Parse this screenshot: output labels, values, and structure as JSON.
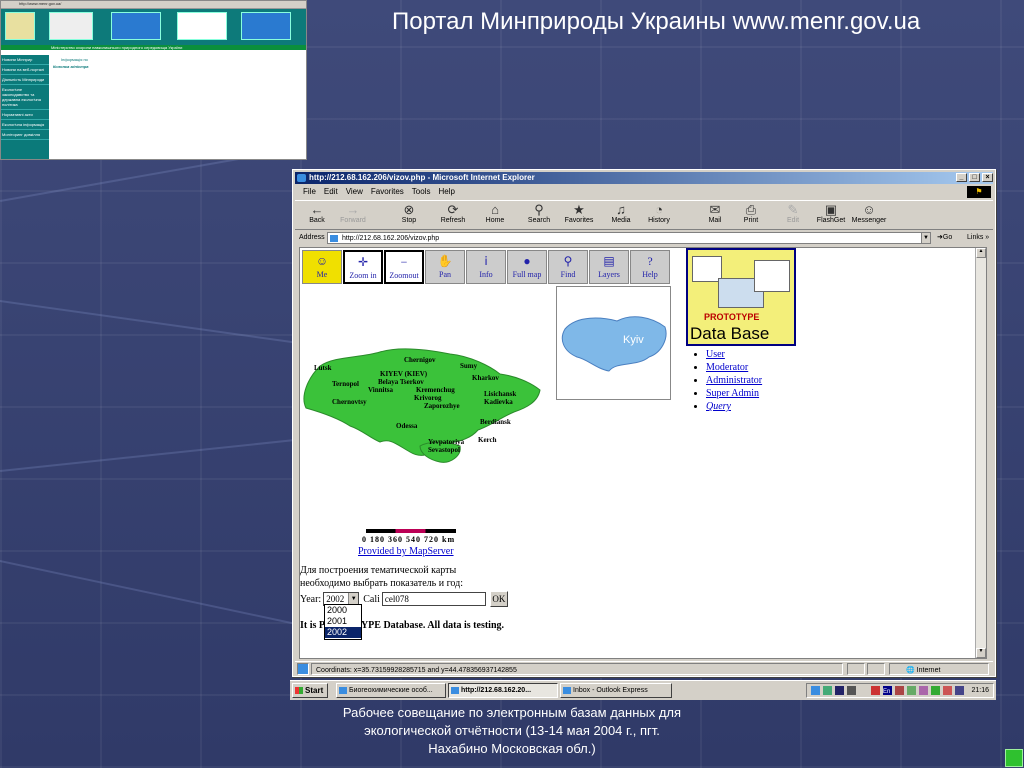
{
  "slide": {
    "title": "Портал Минприроды Украины www.menr.gov.ua",
    "caption": "Рабочее совещание по электронным базам данных для экологической отчётности (13-14 мая 2004 г., пгт. Нахабино Московская обл.)"
  },
  "thumbnail": {
    "address": "http://www.menr.gov.ua/",
    "strip_text": "Міністерство охорони навколишнього природного середовища України",
    "menu_items": [
      "Новини Мінприр",
      "Новини на веб-порталі",
      "Діяльність Мінприроди",
      "Екологічне законодавство та державна екологічна політика",
      "Нормативні акти",
      "Екологічна інформація",
      "Моніторинг довкілля"
    ],
    "body_title": "Колонка міністра",
    "info_label": "Інформація по"
  },
  "window": {
    "title": "http://212.68.162.206/vizov.php - Microsoft Internet Explorer",
    "menu": [
      "File",
      "Edit",
      "View",
      "Favorites",
      "Tools",
      "Help"
    ],
    "toolbar": [
      {
        "label": "Back",
        "icon": "←",
        "disabled": false
      },
      {
        "label": "Forward",
        "icon": "→",
        "disabled": true
      },
      {
        "label": "Stop",
        "icon": "⊗",
        "disabled": false
      },
      {
        "label": "Refresh",
        "icon": "⟳",
        "disabled": false
      },
      {
        "label": "Home",
        "icon": "⌂",
        "disabled": false
      },
      {
        "label": "Search",
        "icon": "⚲",
        "disabled": false
      },
      {
        "label": "Favorites",
        "icon": "★",
        "disabled": false
      },
      {
        "label": "Media",
        "icon": "♫",
        "disabled": false
      },
      {
        "label": "History",
        "icon": "◔",
        "disabled": false
      },
      {
        "label": "Mail",
        "icon": "✉",
        "disabled": false
      },
      {
        "label": "Print",
        "icon": "⎙",
        "disabled": false
      },
      {
        "label": "Edit",
        "icon": "✎",
        "disabled": true
      },
      {
        "label": "FlashGet",
        "icon": "▣",
        "disabled": false
      },
      {
        "label": "Messenger",
        "icon": "☺",
        "disabled": false
      }
    ],
    "address_label": "Address",
    "address": "http://212.68.162.206/vizov.php",
    "go_label": "Go",
    "links_label": "Links",
    "status_coords": "Coordinats: x=35.73159928285715  and y=44.4783569371428​55",
    "status_zone": "Internet"
  },
  "page": {
    "map_buttons": [
      {
        "label": "Me",
        "icon": "☺",
        "state": "active"
      },
      {
        "label": "Zoom in",
        "icon": "✛",
        "state": "sel"
      },
      {
        "label": "Zoomout",
        "icon": "−",
        "state": "sel"
      },
      {
        "label": "Pan",
        "icon": "✋",
        "state": "normal"
      },
      {
        "label": "Info",
        "icon": "ⅰ",
        "state": "normal"
      },
      {
        "label": "Full map",
        "icon": "●",
        "state": "normal"
      },
      {
        "label": "Find",
        "icon": "⚲",
        "state": "normal"
      },
      {
        "label": "Layers",
        "icon": "▤",
        "state": "normal"
      },
      {
        "label": "Help",
        "icon": "?",
        "state": "normal"
      }
    ],
    "overview_label": "Kyiv",
    "proto_top": "PROTOTYPE",
    "proto_db": "Data  Base",
    "user_links": [
      "User",
      "Moderator",
      "Administrator",
      "Super Admin",
      "Query"
    ],
    "cities": [
      "Chernigov",
      "Lutsk",
      "Sumy",
      "KIYEV (KIEV)",
      "Belaya Tserkov",
      "Kharkov",
      "Ternopol",
      "Vinnitsa",
      "Kremenchug",
      "Chernovtsy",
      "Krivorog",
      "Lisichansk",
      "Zaporozhye",
      "Kadievka",
      "Odessa",
      "Berdiansk",
      "Yevpatoriya",
      "Kerch",
      "Sevastopol"
    ],
    "scale_label": "0   180  360  540  720 km",
    "provided_link": "Provided by MapServer",
    "hint_line1": "Для построения тематической карты",
    "hint_line2": "необходимо выбрать показатель и год:",
    "year_label": "Year:",
    "year_value": "2002",
    "cal_label": "Cali",
    "cal_value": "cel078",
    "ok_label": "OK",
    "year_options": [
      "2000",
      "2001",
      "2002"
    ],
    "note": "It is PROTOTYPE Database. All data is testing."
  },
  "taskbar": {
    "start": "Start",
    "tasks": [
      "Биогеохимические особ...",
      "http://212.68.162.20...",
      "Inbox - Outlook Express"
    ],
    "clock": "21:16"
  }
}
